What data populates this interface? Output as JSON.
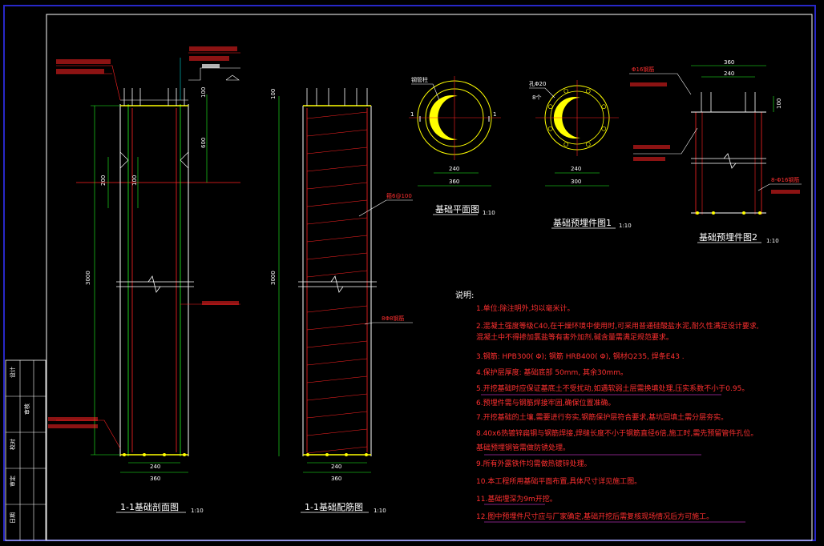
{
  "colors": {
    "background": "#000000",
    "frame": "#ffffff",
    "border_blue": "#2828c8",
    "line_white": "#ffffff",
    "line_red": "#ff2222",
    "line_green": "#22ff22",
    "line_yellow": "#ffff00",
    "line_cyan": "#00d8d8",
    "line_magenta": "#ff44ff",
    "text_red": "#ff3030",
    "text_white": "#ffffff"
  },
  "drawings": {
    "section_1_1": {
      "title": "1-1基础剖面图",
      "scale": "1:10",
      "dim_height": "3000",
      "dim_inner_width": "240",
      "dim_outer_width": "360",
      "dim_top": "100",
      "dim_mid": "600",
      "dim_left_a": "200",
      "dim_left_b": "100"
    },
    "reinforcement_1_1": {
      "title": "1-1基础配筋图",
      "scale": "1:10",
      "dim_height": "3000",
      "dim_top": "100",
      "dim_inner_width": "240",
      "dim_outer_width": "360",
      "callout_stirrup": "箍6@100",
      "callout_main": "8Φ8钢筋"
    },
    "plan": {
      "title": "基础平面图",
      "scale": "1:10",
      "dim_inner": "240",
      "dim_outer": "360",
      "mark_left": "1",
      "mark_right": "1",
      "callout": "钢管柱"
    },
    "embed_1": {
      "title": "基础预埋件图1",
      "scale": "1:10",
      "dim_inner": "240",
      "dim_outer": "300",
      "callout_bolt": "孔Φ20",
      "callout_count": "8个"
    },
    "embed_2": {
      "title": "基础预埋件图2",
      "scale": "1:10",
      "dim_top_outer": "360",
      "dim_top_inner": "240",
      "dim_right": "100",
      "callout_bolt": "Φ16钢筋",
      "callout_side": "8-Φ16钢筋"
    }
  },
  "notes": {
    "heading": "说明:",
    "items": [
      "1.单位:除注明外,均以毫米计。",
      "2.混凝土强度等级C40,在干燥环境中使用时,可采用普通硅酸盐水泥,耐久性满足设计要求,",
      "  混凝土中不得掺加氯盐等有害外加剂,碱含量需满足规范要求。",
      "3.钢筋: HPB300(  Φ); 钢筋 HRB400(  Φ), 钢材Q235, 焊条E43 .",
      "4.保护层厚度: 基础底部 50mm, 其余30mm。",
      "5.开挖基础时应保证基底土不受扰动,如遇软弱土层需换填处理,压实系数不小于0.95。",
      "6.预埋件需与钢筋焊接牢固,确保位置准确。",
      "7.开挖基础的土壤,需要进行夯实,钢筋保护层符合要求,基坑回填土需分层夯实。",
      "8.40x6热镀锌扁钢与钢筋焊接,焊缝长度不小于钢筋直径6倍,施工时,需先预留管件孔位。",
      "  基础预埋钢管需做防锈处理。",
      "9.所有外露铁件均需做热镀锌处理。",
      "10.本工程所用基础平面布置,具体尺寸详见施工图。",
      "11.基础埋深为9m开挖。",
      "12.图中预埋件尺寸应与厂家确定,基础开挖后需复核现场情况后方可施工。"
    ]
  },
  "title_block": {
    "cells": [
      "设计",
      "审核",
      "校对",
      "审定",
      "日期"
    ]
  }
}
